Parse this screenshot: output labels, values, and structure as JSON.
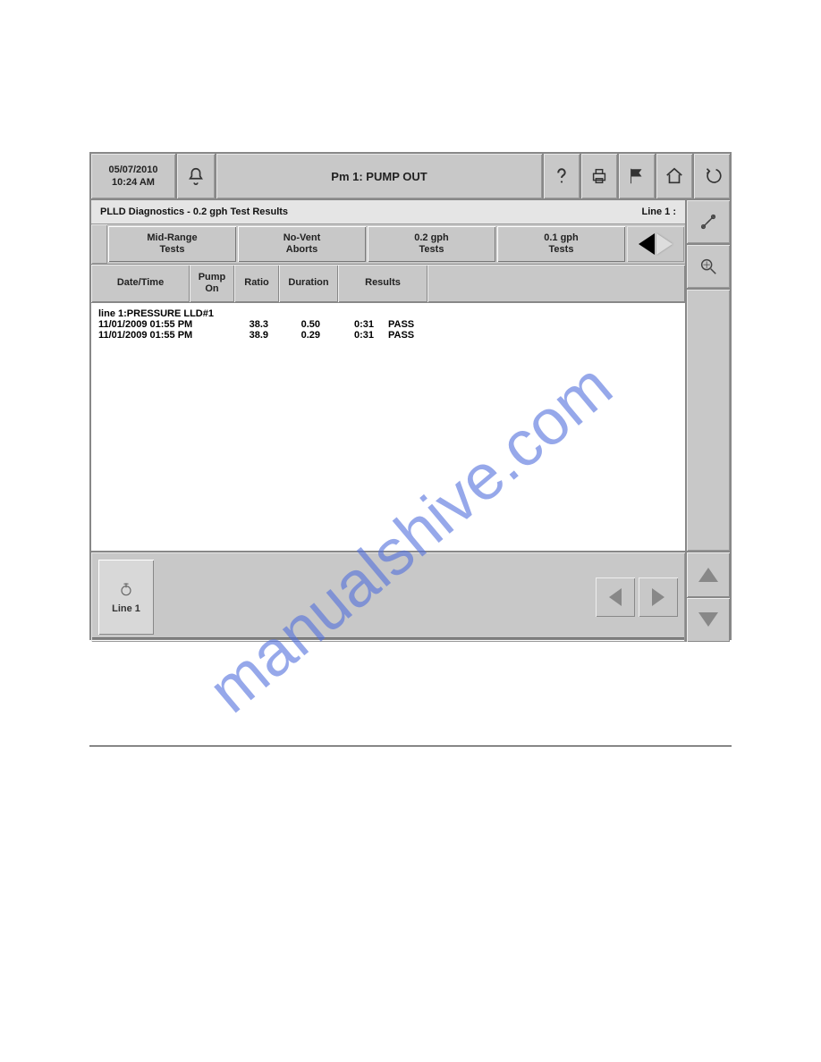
{
  "topbar": {
    "date": "05/07/2010",
    "time": "10:24 AM",
    "title": "Pm 1: PUMP OUT"
  },
  "subtitle": {
    "left": "PLLD Diagnostics - 0.2 gph Test Results",
    "right": "Line 1 :"
  },
  "tabs": [
    {
      "l1": "Mid-Range",
      "l2": "Tests"
    },
    {
      "l1": "No-Vent",
      "l2": "Aborts"
    },
    {
      "l1": "0.2 gph",
      "l2": "Tests"
    },
    {
      "l1": "0.1 gph",
      "l2": "Tests"
    }
  ],
  "columns": {
    "datetime": "Date/Time",
    "pump": "Pump On",
    "ratio": "Ratio",
    "duration": "Duration",
    "results": "Results"
  },
  "group_label": "line 1:PRESSURE LLD#1",
  "rows": [
    {
      "datetime": "11/01/2009 01:55 PM",
      "pump": "38.3",
      "ratio": "0.50",
      "duration": "0:31",
      "results": "PASS"
    },
    {
      "datetime": "11/01/2009 01:55 PM",
      "pump": "38.9",
      "ratio": "0.29",
      "duration": "0:31",
      "results": "PASS"
    }
  ],
  "footer": {
    "line_btn": "Line 1"
  },
  "watermark": "manualshive.com"
}
